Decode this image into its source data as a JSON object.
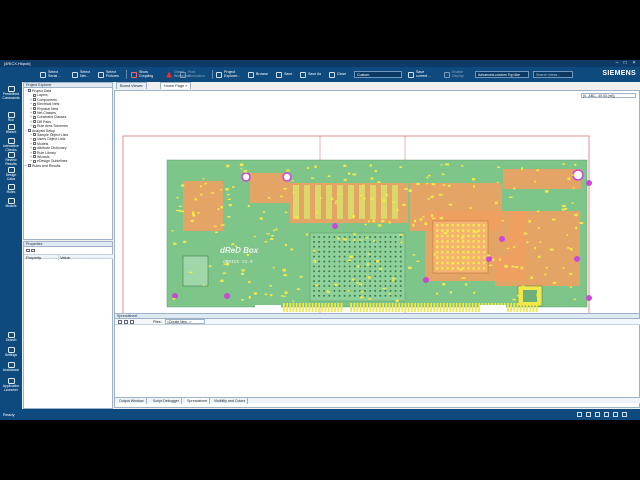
{
  "window": {
    "title": "[4RICX.Hkpcb]"
  },
  "toolbar": {
    "buttons": [
      {
        "label": "Select\nSerial ...",
        "icon": "select-serial-icon"
      },
      {
        "label": "Select\nNet...",
        "icon": "select-net-icon"
      },
      {
        "label": "Select\nFixtures",
        "icon": "select-fixtures-icon"
      },
      {
        "label": "Show\nCoupling",
        "icon": "coupling-icon"
      },
      {
        "label": "Check\nWorkbook",
        "icon": "warning-icon"
      },
      {
        "label": "Post\nSimulation",
        "icon": "post-sim-icon"
      },
      {
        "label": "Project\nExplorer...",
        "icon": "project-explorer-icon"
      },
      {
        "label": "Browse",
        "icon": "browse-icon"
      },
      {
        "label": "Save",
        "icon": "save-icon"
      },
      {
        "label": "Save As",
        "icon": "save-as-icon"
      },
      {
        "label": "Close",
        "icon": "close-doc-icon"
      }
    ],
    "mode_select": "Custom",
    "save_current_label": "Save\ncurrent ...",
    "disabled_label": "Enable\nDisplay",
    "layer_combo": "Advanced-custom Top like",
    "search_placeholder": "Search Ideas..."
  },
  "brand": "SIEMENS",
  "rail": [
    {
      "label": "Predefined\nCommands",
      "icon": "commands-icon"
    },
    {
      "label": "Run",
      "icon": "run-icon"
    },
    {
      "label": "Wizard",
      "icon": "wizard-icon"
    },
    {
      "label": "Interactive\nChecks",
      "icon": "checks-icon"
    },
    {
      "label": "Review\nResults",
      "icon": "results-icon"
    },
    {
      "label": "Design\nCalcs",
      "icon": "calc-icon"
    },
    {
      "label": "Rules",
      "icon": "rules-icon"
    },
    {
      "label": "Models",
      "icon": "models-icon"
    },
    {
      "label": "Search",
      "icon": "search-icon"
    },
    {
      "label": "Settings",
      "icon": "settings-icon"
    },
    {
      "label": "Assistance",
      "icon": "assistance-icon"
    },
    {
      "label": "Application\nLauncher",
      "icon": "launcher-icon"
    }
  ],
  "project_explorer": {
    "title": "Project Explorer",
    "items": [
      {
        "label": "Project Data",
        "level": 0,
        "exp": "−"
      },
      {
        "label": "Layers",
        "level": 1,
        "exp": ""
      },
      {
        "label": "Components",
        "level": 1,
        "exp": "+"
      },
      {
        "label": "Electrical Nets",
        "level": 1,
        "exp": "+"
      },
      {
        "label": "Physical Nets",
        "level": 1,
        "exp": "+"
      },
      {
        "label": "Net Classes",
        "level": 1,
        "exp": "+"
      },
      {
        "label": "Constraint Classes",
        "level": 1,
        "exp": "+"
      },
      {
        "label": "Diff Pairs",
        "level": 1,
        "exp": "+"
      },
      {
        "label": "Rule Area Schemes",
        "level": 1,
        "exp": "+"
      },
      {
        "label": "Analysis Setup",
        "level": 0,
        "exp": "−"
      },
      {
        "label": "Sample Object Lists",
        "level": 1,
        "exp": "+"
      },
      {
        "label": "Users Object Lists",
        "level": 1,
        "exp": "+"
      },
      {
        "label": "Models",
        "level": 1,
        "exp": "+"
      },
      {
        "label": "Attribute Dictionary",
        "level": 1,
        "exp": "+"
      },
      {
        "label": "Rule Library",
        "level": 1,
        "exp": "+"
      },
      {
        "label": "Wizards",
        "level": 1,
        "exp": "+"
      },
      {
        "label": "eDesign Guidelines",
        "level": 1,
        "exp": "+"
      },
      {
        "label": "Rules and Results",
        "level": 0,
        "exp": "+"
      }
    ]
  },
  "properties": {
    "title": "Properties",
    "columns": [
      "Property",
      "Value"
    ]
  },
  "doc_tabs": [
    {
      "label": "Board Viewer"
    },
    {
      "label": "Home Page"
    }
  ],
  "view_combo": "(ii. ,ABC...40.03 (ml))",
  "board": {
    "silkscreen_title": "dReD Box",
    "silkscreen_sub": "dBRICK V1.0",
    "colors": {
      "base": "#7ec58a",
      "copper": "#f0a060",
      "pad": "#f2e84a",
      "via": "#c94ad6",
      "outline": "#d04040"
    }
  },
  "spreadsheet": {
    "title": "Spreadsheet",
    "files_label": "Files:",
    "files_value": "<Create New...>"
  },
  "bottom_tabs": [
    "Output Window",
    "Script Debugger",
    "Spreadsheet",
    "Visibility and Colors"
  ],
  "status": {
    "text": "Ready"
  }
}
